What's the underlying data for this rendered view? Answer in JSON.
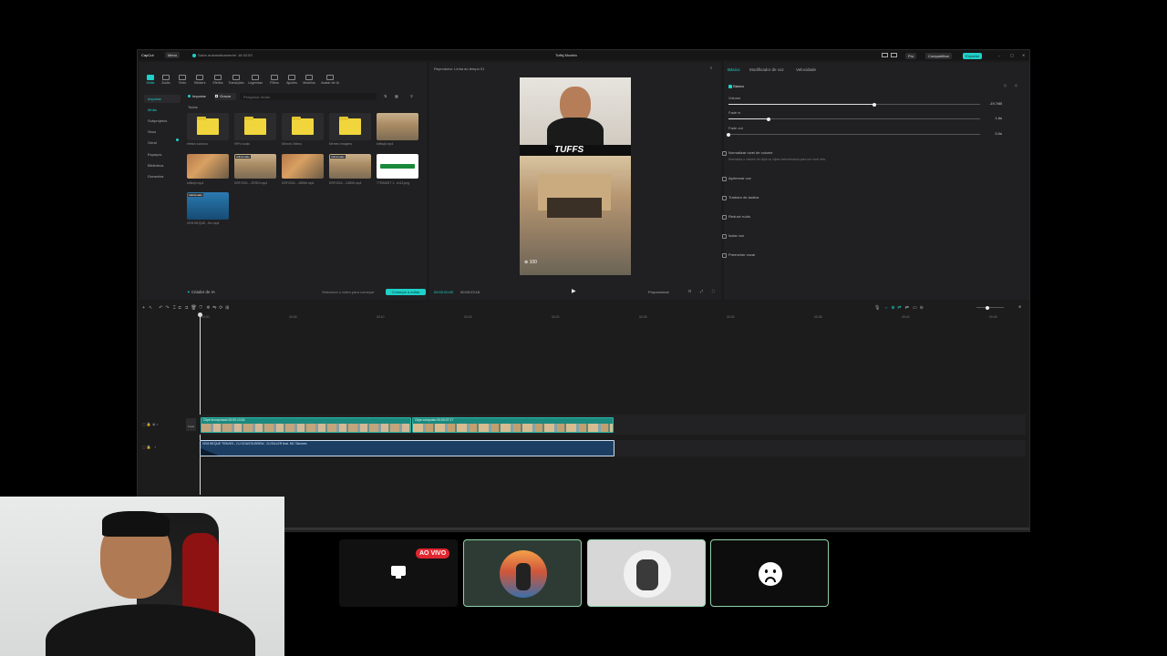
{
  "titlebar": {
    "app_name": "CapCut",
    "menu_label": "Menu",
    "autosave": "Salvo automaticamente: 16:42:53",
    "project_title": "Tuffsj Modelo",
    "pro_label": "Pro",
    "share_label": "Compartilhar",
    "export_label": "Exportar"
  },
  "toolbar": {
    "items": [
      "Mídia",
      "Áudio",
      "Texto",
      "Stickers",
      "Efeitos",
      "Transições",
      "Legendas",
      "Filtros",
      "Ajustes",
      "Modelos",
      "Avatar de IA"
    ]
  },
  "media_sidebar": {
    "items": [
      "Importar",
      "Mídia",
      "Subprojetos",
      "Seus",
      "Geral",
      "Espaços",
      "Biblioteca",
      "Dreamina"
    ]
  },
  "media_panel": {
    "import_label": "Importar",
    "record_label": "Gravar",
    "search_placeholder": "Pesquisar mídia",
    "section_title": "Todos",
    "folders": [
      "efeitos sonoros",
      "HIPs locais",
      "Mirrors Videos",
      "Memes Imagens"
    ],
    "files": [
      {
        "name": "tuffssjh.mp4",
        "badge": ""
      },
      {
        "name": "tuffssjh.mp4",
        "badge": ""
      },
      {
        "name": "tuffssjh.mp4",
        "badge": "Adicionado"
      },
      {
        "name": "DRF2024-...ZERDI.mp4",
        "badge": "Adicionado"
      },
      {
        "name": "DRF2024-...08966.mp4",
        "badge": ""
      },
      {
        "name": "DRF2024-...24806.mp4",
        "badge": "Adicionado"
      },
      {
        "name": "7TRANSIT 1...ch13.png",
        "badge": ""
      },
      {
        "name": "VEM BEQUE...Kio.mp4",
        "badge": "Adicionado"
      }
    ],
    "creator_label": "Criador de IA",
    "hint": "Selecione o vídeo para começar",
    "cta_label": "Começar a editar"
  },
  "player": {
    "title": "Reprodutor: Linha do tempo 01",
    "time_current": "00:00:00:00",
    "time_total": "00:00:23:16",
    "ratio_label": "Proporcional",
    "overlay_text": "TUFFS",
    "score": "100"
  },
  "properties": {
    "tabs": [
      "Básico",
      "Modificador de voz",
      "Velocidade"
    ],
    "section_basic": "Básico",
    "volume_label": "Volume",
    "volume_value": "-19.7dB",
    "volume_level": 0.58,
    "fade_in_label": "Fade in",
    "fade_in_value": "1.6s",
    "fade_in_level": 0.16,
    "fade_out_label": "Fade out",
    "fade_out_value": "0.0s",
    "fade_out_level": 0.0,
    "normalize_label": "Normalizar nível de volume",
    "normalize_desc": "Normaliza o volume do clipe ou clipes selecionados para um nível alvo.",
    "options": [
      "Aprimorar voz",
      "Tradutor de áudios",
      "Reduzir ruído",
      "Isolar voz",
      "Preencher vocal"
    ]
  },
  "timeline": {
    "ruler": [
      "00:00",
      "00:05",
      "00:10",
      "00:15",
      "00:20",
      "00:25",
      "00:30",
      "00:35",
      "00:40",
      "00:45",
      "00:50"
    ],
    "video_clip_1": "Clipe incorporado 00:00:13:16",
    "video_clip_2": "Clipe composto 00:00:07:17",
    "cover_label": "Capa",
    "audio_clip": "VEM BEQUE TRAVES - DJ GOUSTA BREW - DJ BILLER feat. MC Talumes"
  },
  "stream": {
    "live_badge": "AO VIVO"
  },
  "colors": {
    "accent": "#1fd0c8",
    "live": "#e0262f",
    "audio_clip": "#1c3e63",
    "video_clip": "#1b8a7e"
  }
}
